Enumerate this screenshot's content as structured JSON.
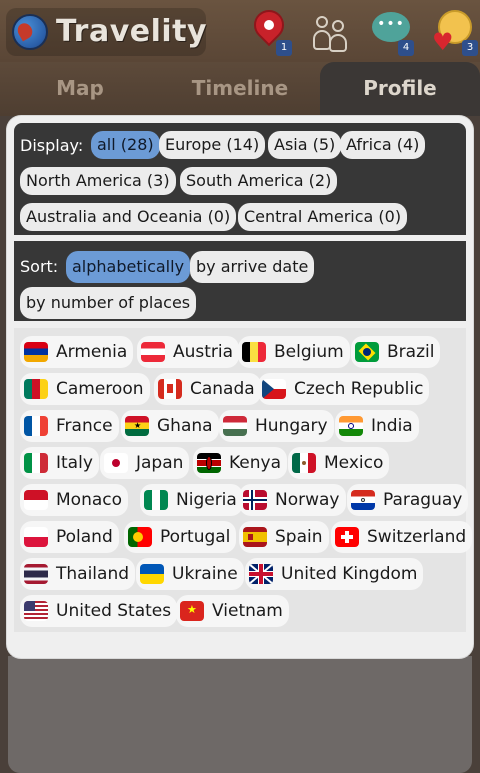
{
  "app": {
    "title": "Travelity",
    "icons": [
      {
        "name": "map-pin-icon",
        "badge": "1"
      },
      {
        "name": "people-icon",
        "badge": ""
      },
      {
        "name": "chat-icon",
        "badge": "4"
      },
      {
        "name": "smiley-heart-icon",
        "badge": "3"
      }
    ]
  },
  "tabs": [
    {
      "label": "Map",
      "active": false
    },
    {
      "label": "Timeline",
      "active": false
    },
    {
      "label": "Profile",
      "active": true
    }
  ],
  "display": {
    "label": "Display:",
    "options": [
      {
        "label": "all (28)",
        "selected": true
      },
      {
        "label": "Europe (14)",
        "selected": false
      },
      {
        "label": "Asia (5)",
        "selected": false
      },
      {
        "label": "Africa (4)",
        "selected": false
      },
      {
        "label": "North America (3)",
        "selected": false
      },
      {
        "label": "South America (2)",
        "selected": false
      },
      {
        "label": "Australia and Oceania (0)",
        "selected": false
      },
      {
        "label": "Central America (0)",
        "selected": false
      }
    ]
  },
  "sort": {
    "label": "Sort:",
    "options": [
      {
        "label": "alphabetically",
        "selected": true
      },
      {
        "label": "by arrive date",
        "selected": false
      },
      {
        "label": "by number of places",
        "selected": false
      }
    ]
  },
  "countries": [
    {
      "name": "Armenia",
      "flag": "armenia-flag-icon"
    },
    {
      "name": "Austria",
      "flag": "austria-flag-icon"
    },
    {
      "name": "Belgium",
      "flag": "belgium-flag-icon"
    },
    {
      "name": "Brazil",
      "flag": "brazil-flag-icon"
    },
    {
      "name": "Cameroon",
      "flag": "cameroon-flag-icon"
    },
    {
      "name": "Canada",
      "flag": "canada-flag-icon"
    },
    {
      "name": "Czech Republic",
      "flag": "czech-flag-icon"
    },
    {
      "name": "France",
      "flag": "france-flag-icon"
    },
    {
      "name": "Ghana",
      "flag": "ghana-flag-icon"
    },
    {
      "name": "Hungary",
      "flag": "hungary-flag-icon"
    },
    {
      "name": "India",
      "flag": "india-flag-icon"
    },
    {
      "name": "Italy",
      "flag": "italy-flag-icon"
    },
    {
      "name": "Japan",
      "flag": "japan-flag-icon"
    },
    {
      "name": "Kenya",
      "flag": "kenya-flag-icon"
    },
    {
      "name": "Mexico",
      "flag": "mexico-flag-icon"
    },
    {
      "name": "Monaco",
      "flag": "monaco-flag-icon"
    },
    {
      "name": "Nigeria",
      "flag": "nigeria-flag-icon"
    },
    {
      "name": "Norway",
      "flag": "norway-flag-icon"
    },
    {
      "name": "Paraguay",
      "flag": "paraguay-flag-icon"
    },
    {
      "name": "Poland",
      "flag": "poland-flag-icon"
    },
    {
      "name": "Portugal",
      "flag": "portugal-flag-icon"
    },
    {
      "name": "Spain",
      "flag": "spain-flag-icon"
    },
    {
      "name": "Switzerland",
      "flag": "switzerland-flag-icon"
    },
    {
      "name": "Thailand",
      "flag": "thailand-flag-icon"
    },
    {
      "name": "Ukraine",
      "flag": "ukraine-flag-icon"
    },
    {
      "name": "United Kingdom",
      "flag": "uk-flag-icon"
    },
    {
      "name": "United States",
      "flag": "usa-flag-icon"
    },
    {
      "name": "Vietnam",
      "flag": "vietnam-flag-icon"
    }
  ],
  "colors": {
    "selected_chip": "#6c9bd6",
    "section_dark": "#373737",
    "badge": "#2e4f8c"
  }
}
